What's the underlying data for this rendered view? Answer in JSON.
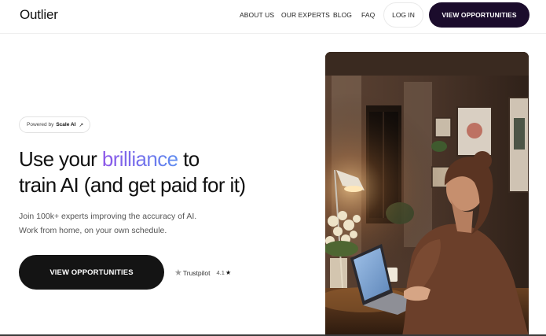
{
  "header": {
    "logo": "Outlier",
    "nav": [
      "ABOUT US",
      "OUR EXPERTS",
      "BLOG",
      "FAQ"
    ],
    "login": "LOG IN",
    "cta": "VIEW OPPORTUNITIES"
  },
  "hero": {
    "badge_prefix": "Powered by",
    "badge_brand": "Scale AI",
    "badge_icon": "arrow-up-right-icon",
    "title_before": "Use your ",
    "title_accent": "brilliance",
    "title_after": " to",
    "title_line2": "train AI (and get paid for it)",
    "subtitle_line1": "Join 100k+ experts improving the accuracy of AI.",
    "subtitle_line2": "Work from home, on your own schedule.",
    "cta": "VIEW OPPORTUNITIES",
    "trustpilot_label": "Trustpilot",
    "rating": "4.1"
  },
  "colors": {
    "header_cta_bg": "#1b0c2c",
    "main_cta_bg": "#141414",
    "accent_gradient_start": "#8d56e8",
    "accent_gradient_end": "#5f8df0"
  }
}
